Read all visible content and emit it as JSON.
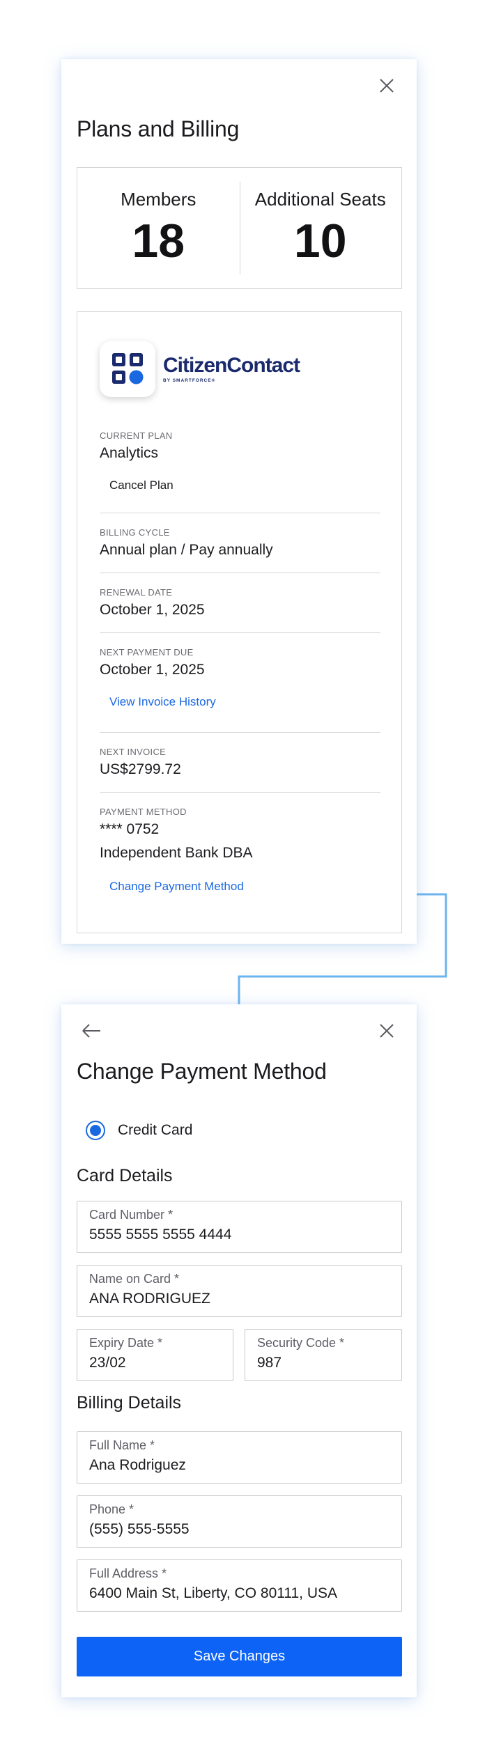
{
  "plans": {
    "title": "Plans and Billing",
    "members_label": "Members",
    "members_value": "18",
    "seats_label": "Additional Seats",
    "seats_value": "10",
    "logo": {
      "name": "CitizenContact",
      "sub": "BY SMARTFORCE®",
      "icon": "citizencontact-logo-icon",
      "color": "#1a2a6c",
      "accent": "#1a68e0"
    },
    "current_plan_label": "CURRENT PLAN",
    "current_plan_value": "Analytics",
    "cancel_label": "Cancel Plan",
    "billing_cycle_label": "BILLING CYCLE",
    "billing_cycle_value": "Annual plan / Pay annually",
    "renewal_label": "RENEWAL DATE",
    "renewal_value": "October 1, 2025",
    "next_payment_label": "NEXT PAYMENT DUE",
    "next_payment_value": "October 1, 2025",
    "invoice_history_label": "View Invoice History",
    "next_invoice_label": "NEXT INVOICE",
    "next_invoice_value": "US$2799.72",
    "payment_method_label": "PAYMENT METHOD",
    "payment_card": "**** 0752",
    "payment_bank": "Independent Bank DBA",
    "change_payment_label": "Change Payment Method"
  },
  "change_payment": {
    "title": "Change Payment Method",
    "radio_label": "Credit Card",
    "card_section": "Card Details",
    "card_number_label": "Card Number *",
    "card_number_value": "5555 5555 5555 4444",
    "name_label": "Name on Card *",
    "name_value": "ANA RODRIGUEZ",
    "expiry_label": "Expiry Date *",
    "expiry_value": "23/02",
    "security_label": "Security Code *",
    "security_value": "987",
    "billing_section": "Billing Details",
    "full_name_label": "Full Name *",
    "full_name_value": "Ana Rodriguez",
    "phone_label": "Phone *",
    "phone_value": "(555) 555-5555",
    "address_label": "Full Address *",
    "address_value": "6400 Main St, Liberty, CO 80111, USA",
    "save_label": "Save Changes"
  },
  "colors": {
    "primary": "#0d63f6",
    "link": "#1a68e0",
    "connector": "#6cb4ee",
    "border": "#d6d6d9"
  },
  "icons": [
    "close-icon",
    "back-arrow-icon",
    "citizencontact-logo-icon"
  ]
}
